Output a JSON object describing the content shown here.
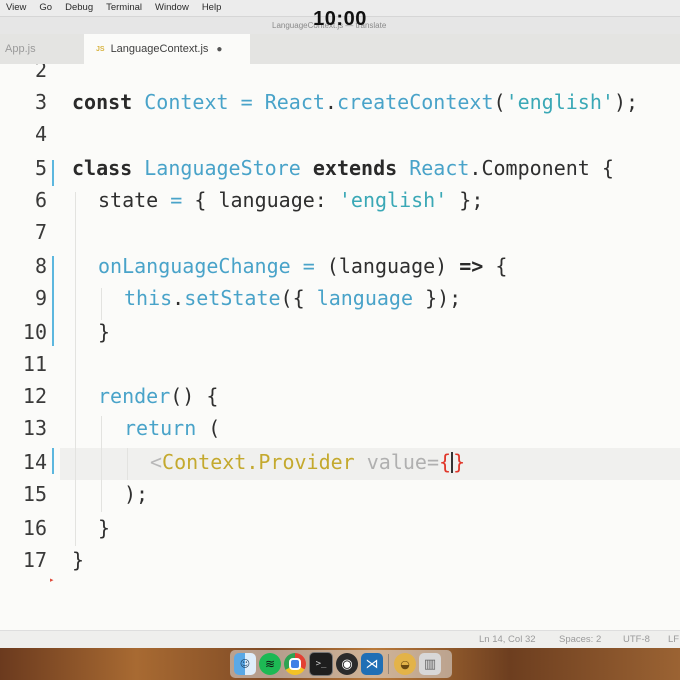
{
  "menubar": {
    "items": [
      "View",
      "Go",
      "Debug",
      "Terminal",
      "Window",
      "Help"
    ],
    "clock": "10:00"
  },
  "window": {
    "title": "LanguageContext.js — translate"
  },
  "tabs": [
    {
      "label": "App.js",
      "active": false
    },
    {
      "label": "LanguageContext.js",
      "active": true,
      "modified": true
    }
  ],
  "editor": {
    "line_numbers": [
      "2",
      "3",
      "4",
      "5",
      "6",
      "7",
      "8",
      "9",
      "10",
      "11",
      "12",
      "13",
      "14",
      "15",
      "16",
      "17"
    ],
    "code": {
      "l3_kw": "const",
      "l3_name": "Context",
      "l3_op": "=",
      "l3_obj": "React",
      "l3_dot": ".",
      "l3_fn": "createContext",
      "l3_open": "(",
      "l3_str": "'english'",
      "l3_close": ");",
      "l5_kw": "class",
      "l5_name": "LanguageStore",
      "l5_ext": "extends",
      "l5_obj": "React",
      "l5_rest": ".Component {",
      "l6_prop": "state",
      "l6_op": "=",
      "l6_open": "{ language:",
      "l6_str": "'english'",
      "l6_close": "};",
      "l8_name": "onLanguageChange",
      "l8_op": "=",
      "l8_args": "(language)",
      "l8_arrow": "=>",
      "l8_brace": "{",
      "l9_this": "this",
      "l9_dot": ".",
      "l9_fn": "setState",
      "l9_open": "({",
      "l9_arg": "language",
      "l9_close": "});",
      "l10_close": "}",
      "l12_fn": "render",
      "l12_rest": "() {",
      "l13_kw": "return",
      "l13_rest": "(",
      "l14_lt": "<",
      "l14_tag": "Context.Provider",
      "l14_attr": "value",
      "l14_eq": "=",
      "l14_lbrace": "{",
      "l14_rbrace": "}",
      "l15_close": ");",
      "l16_close": "}",
      "l17_close": "}"
    }
  },
  "statusbar": {
    "position": "Ln 14, Col 32",
    "spaces": "Spaces: 2",
    "encoding": "UTF-8",
    "eol": "LF"
  },
  "dock": {
    "apps": [
      "finder-icon",
      "spotify-icon",
      "chrome-icon",
      "terminal-icon",
      "obs-icon",
      "vscode-icon",
      "app-icon",
      "trash-icon"
    ]
  }
}
